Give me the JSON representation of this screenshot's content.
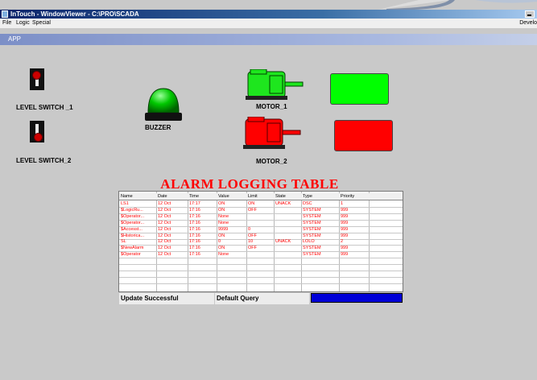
{
  "window": {
    "title": "InTouch - WindowViewer - C:\\PRO\\SCADA",
    "menus": [
      "File",
      "Logic",
      "Special"
    ],
    "menu_right": "Develo"
  },
  "app_title": "APP",
  "labels": {
    "level_switch_1": "LEVEL SWITCH _1",
    "level_switch_2": "LEVEL SWITCH_2",
    "buzzer": "BUZZER",
    "motor_1": "MOTOR_1",
    "motor_2": "MOTOR_2"
  },
  "colors": {
    "motor_1": "#1ee61e",
    "motor_2": "#ff0000",
    "status_1": "#00ff00",
    "status_2": "#ff0000",
    "buzzer": "#00c800",
    "alarm_text": "#ff0000",
    "progress": "#0000d8"
  },
  "alarm_table": {
    "title": "ALARM LOGGING TABLE",
    "columns": [
      "Name",
      "Date",
      "Time",
      "Value",
      "Limit",
      "State",
      "Type",
      "Priority"
    ],
    "rows": [
      [
        "LS1",
        "12 Oct",
        "17:17",
        "ON",
        "ON",
        "UNACK",
        "DSC",
        "1"
      ],
      [
        "$LogicRu...",
        "12 Oct",
        "17:16",
        "ON",
        "OFF",
        "",
        "SYSTEM",
        "999"
      ],
      [
        "$Operator...",
        "12 Oct",
        "17:16",
        "None",
        "",
        "",
        "SYSTEM",
        "999"
      ],
      [
        "$Operator...",
        "12 Oct",
        "17:16",
        "None",
        "",
        "",
        "SYSTEM",
        "999"
      ],
      [
        "$Accesst...",
        "12 Oct",
        "17:16",
        "9999",
        "0",
        "",
        "SYSTEM",
        "999"
      ],
      [
        "$Historica...",
        "12 Oct",
        "17:16",
        "ON",
        "OFF",
        "",
        "SYSTEM",
        "999"
      ],
      [
        "SL",
        "12 Oct",
        "17:16",
        "0",
        "10",
        "UNACK",
        "LOLO",
        "2"
      ],
      [
        "$NewAlarm",
        "12 Oct",
        "17:16",
        "ON",
        "OFF",
        "",
        "SYSTEM",
        "999"
      ],
      [
        "$Operator",
        "12 Oct",
        "17:16",
        "None",
        "",
        "",
        "SYSTEM",
        "999"
      ]
    ],
    "empty_rows": 4
  },
  "status": {
    "message": "Update Successful",
    "query": "Default Query"
  },
  "icons": [
    "window-app-icon",
    "minimize-icon",
    "toggle-switch-icon",
    "buzzer-lamp-icon",
    "motor-icon"
  ]
}
